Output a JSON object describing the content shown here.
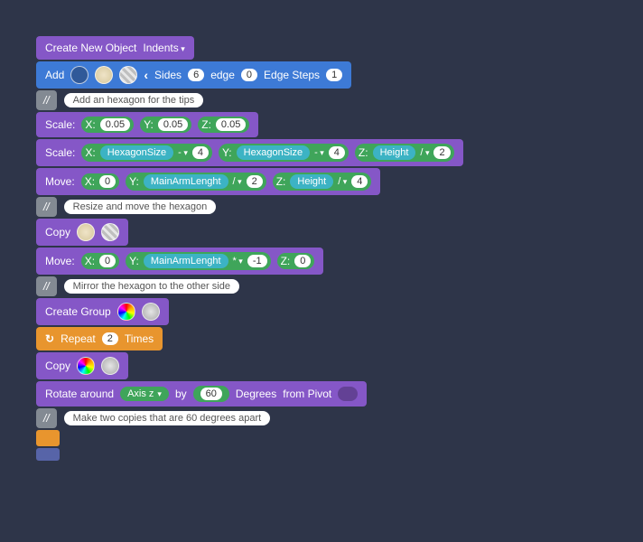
{
  "header": {
    "createNew": "Create New Object",
    "indents": "Indents"
  },
  "add": {
    "label": "Add",
    "sides_lbl": "Sides",
    "sides": "6",
    "edge_lbl": "edge",
    "edge": "0",
    "edgeSteps_lbl": "Edge Steps",
    "edgeSteps": "1"
  },
  "comments": {
    "c1": "Add an hexagon for the tips",
    "c2": "Resize and move the hexagon",
    "c3": "Mirror the hexagon to the other side",
    "c4": "Make two copies that are 60 degrees apart",
    "slash": "//"
  },
  "scale1": {
    "label": "Scale:",
    "xl": "X:",
    "x": "0.05",
    "yl": "Y:",
    "y": "0.05",
    "zl": "Z:",
    "z": "0.05"
  },
  "scale2": {
    "label": "Scale:",
    "xl": "X:",
    "xvar": "HexagonSize",
    "xop": "-",
    "xval": "4",
    "yl": "Y:",
    "yvar": "HexagonSize",
    "yop": "-",
    "yval": "4",
    "zl": "Z:",
    "zvar": "Height",
    "zop": "/",
    "zval": "2"
  },
  "move1": {
    "label": "Move:",
    "xl": "X:",
    "x": "0",
    "yl": "Y:",
    "yvar": "MainArmLenght",
    "yop": "/",
    "yval": "2",
    "zl": "Z:",
    "zvar": "Height",
    "zop": "/",
    "zval": "4"
  },
  "copy1": {
    "label": "Copy"
  },
  "move2": {
    "label": "Move:",
    "xl": "X:",
    "x": "0",
    "yl": "Y:",
    "yvar": "MainArmLenght",
    "yop": "*",
    "yval": "-1",
    "zl": "Z:",
    "z": "0"
  },
  "group": {
    "label": "Create Group"
  },
  "repeat": {
    "label": "Repeat",
    "times": "2",
    "timesLabel": "Times"
  },
  "copy2": {
    "label": "Copy"
  },
  "rotate": {
    "label": "Rotate around",
    "axisLabel": "Axis z",
    "by": "by",
    "deg": "60",
    "degLabel": "Degrees",
    "from": "from Pivot"
  }
}
